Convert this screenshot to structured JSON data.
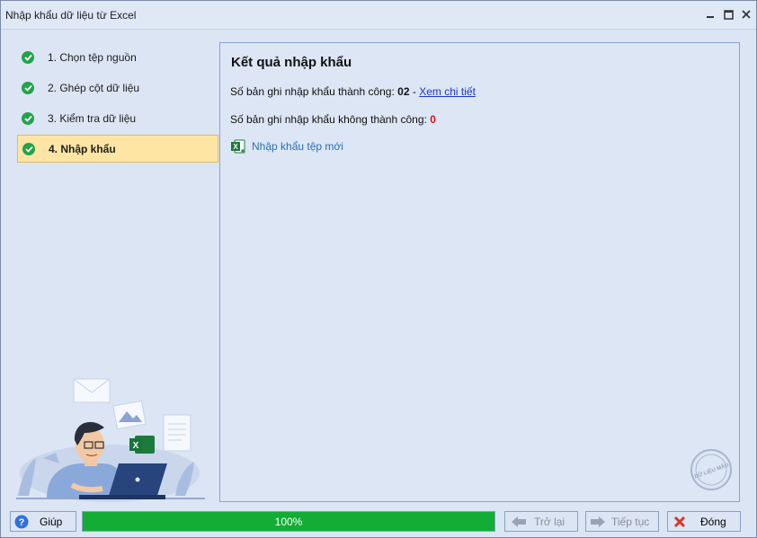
{
  "window": {
    "title": "Nhập khẩu dữ liệu từ Excel"
  },
  "steps": [
    {
      "label": "1. Chọn tệp nguồn",
      "done": true
    },
    {
      "label": "2. Ghép cột dữ liệu",
      "done": true
    },
    {
      "label": "3. Kiểm tra dữ liệu",
      "done": true
    },
    {
      "label": "4. Nhập khẩu",
      "done": true,
      "active": true
    }
  ],
  "result": {
    "heading": "Kết quả nhập khẩu",
    "success_label": "Số bản ghi nhập khẩu thành công:",
    "success_count": "02",
    "separator": "-",
    "detail_link": "Xem chi tiết",
    "fail_label": "Số bản ghi nhập khẩu không thành công:",
    "fail_count": "0",
    "new_file_link": "Nhập khẩu tệp mới"
  },
  "stamp_text": "DỮ LIỆU MẪU",
  "footer": {
    "help_label": "Giúp",
    "progress_text": "100%",
    "progress_value": 1.0,
    "back_label": "Trở lại",
    "next_label": "Tiếp tục",
    "close_label": "Đóng"
  },
  "colors": {
    "accent_green": "#13ad35",
    "active_step_bg": "#ffe5a4",
    "fail_red": "#e01010",
    "link_blue": "#1b36c8"
  },
  "icons": {
    "step_status": "check-circle-icon",
    "excel": "excel-icon",
    "help": "help-icon",
    "back": "arrow-left-icon",
    "next": "arrow-right-icon",
    "close": "close-x-icon"
  }
}
